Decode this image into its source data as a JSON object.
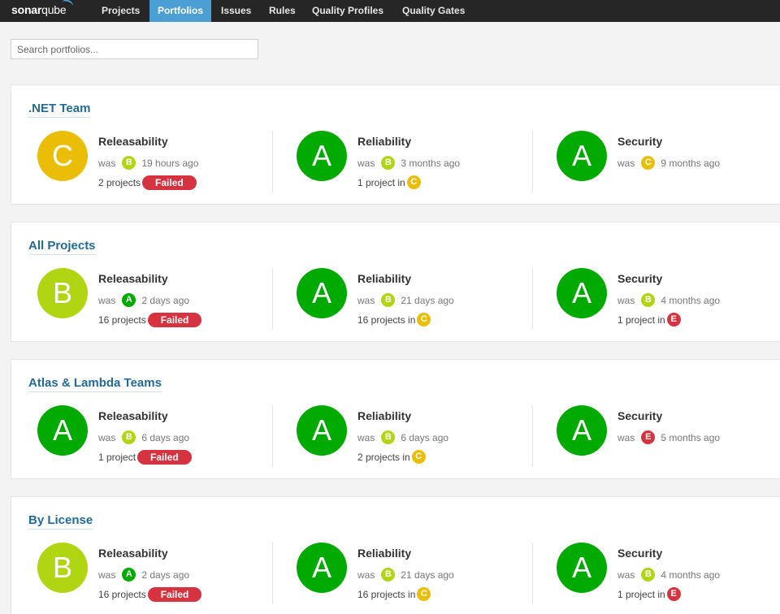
{
  "app": {
    "logo_main": "sonar",
    "logo_sub": "qube"
  },
  "nav": [
    {
      "label": "Projects",
      "active": false
    },
    {
      "label": "Portfolios",
      "active": true
    },
    {
      "label": "Issues",
      "active": false
    },
    {
      "label": "Rules",
      "active": false
    },
    {
      "label": "Quality Profiles",
      "active": false
    },
    {
      "label": "Quality Gates",
      "active": false
    }
  ],
  "search": {
    "placeholder": "Search portfolios..."
  },
  "colors": {
    "A": "#00aa00",
    "B": "#b0d513",
    "C": "#eabe06",
    "E": "#d4333f",
    "accent": "#4b9fd5",
    "link": "#236a97"
  },
  "portfolios": [
    {
      "name": ".NET Team",
      "releasability": {
        "label": "Releasability",
        "rating": "C",
        "was_label": "was",
        "was_rating": "B",
        "was_time": "19 hours ago",
        "projects": "2 projects",
        "status": "Failed"
      },
      "reliability": {
        "label": "Reliability",
        "rating": "A",
        "was_label": "was",
        "was_rating": "B",
        "was_time": "3 months ago",
        "projects": "1 project in",
        "projects_rating": "C"
      },
      "security": {
        "label": "Security",
        "rating": "A",
        "was_label": "was",
        "was_rating": "C",
        "was_time": "9 months ago"
      }
    },
    {
      "name": "All Projects",
      "releasability": {
        "label": "Releasability",
        "rating": "B",
        "was_label": "was",
        "was_rating": "A",
        "was_time": "2 days ago",
        "projects": "16 projects",
        "status": "Failed"
      },
      "reliability": {
        "label": "Reliability",
        "rating": "A",
        "was_label": "was",
        "was_rating": "B",
        "was_time": "21 days ago",
        "projects": "16 projects in",
        "projects_rating": "C"
      },
      "security": {
        "label": "Security",
        "rating": "A",
        "was_label": "was",
        "was_rating": "B",
        "was_time": "4 months ago",
        "projects": "1 project in",
        "projects_rating": "E"
      }
    },
    {
      "name": "Atlas & Lambda Teams",
      "releasability": {
        "label": "Releasability",
        "rating": "A",
        "was_label": "was",
        "was_rating": "B",
        "was_time": "6 days ago",
        "projects": "1 project",
        "status": "Failed"
      },
      "reliability": {
        "label": "Reliability",
        "rating": "A",
        "was_label": "was",
        "was_rating": "B",
        "was_time": "6 days ago",
        "projects": "2 projects in",
        "projects_rating": "C"
      },
      "security": {
        "label": "Security",
        "rating": "A",
        "was_label": "was",
        "was_rating": "E",
        "was_time": "5 months ago"
      }
    },
    {
      "name": "By License",
      "releasability": {
        "label": "Releasability",
        "rating": "B",
        "was_label": "was",
        "was_rating": "A",
        "was_time": "2 days ago",
        "projects": "16 projects",
        "status": "Failed"
      },
      "reliability": {
        "label": "Reliability",
        "rating": "A",
        "was_label": "was",
        "was_rating": "B",
        "was_time": "21 days ago",
        "projects": "16 projects in",
        "projects_rating": "C"
      },
      "security": {
        "label": "Security",
        "rating": "A",
        "was_label": "was",
        "was_rating": "B",
        "was_time": "4 months ago",
        "projects": "1 project in",
        "projects_rating": "E"
      }
    }
  ]
}
